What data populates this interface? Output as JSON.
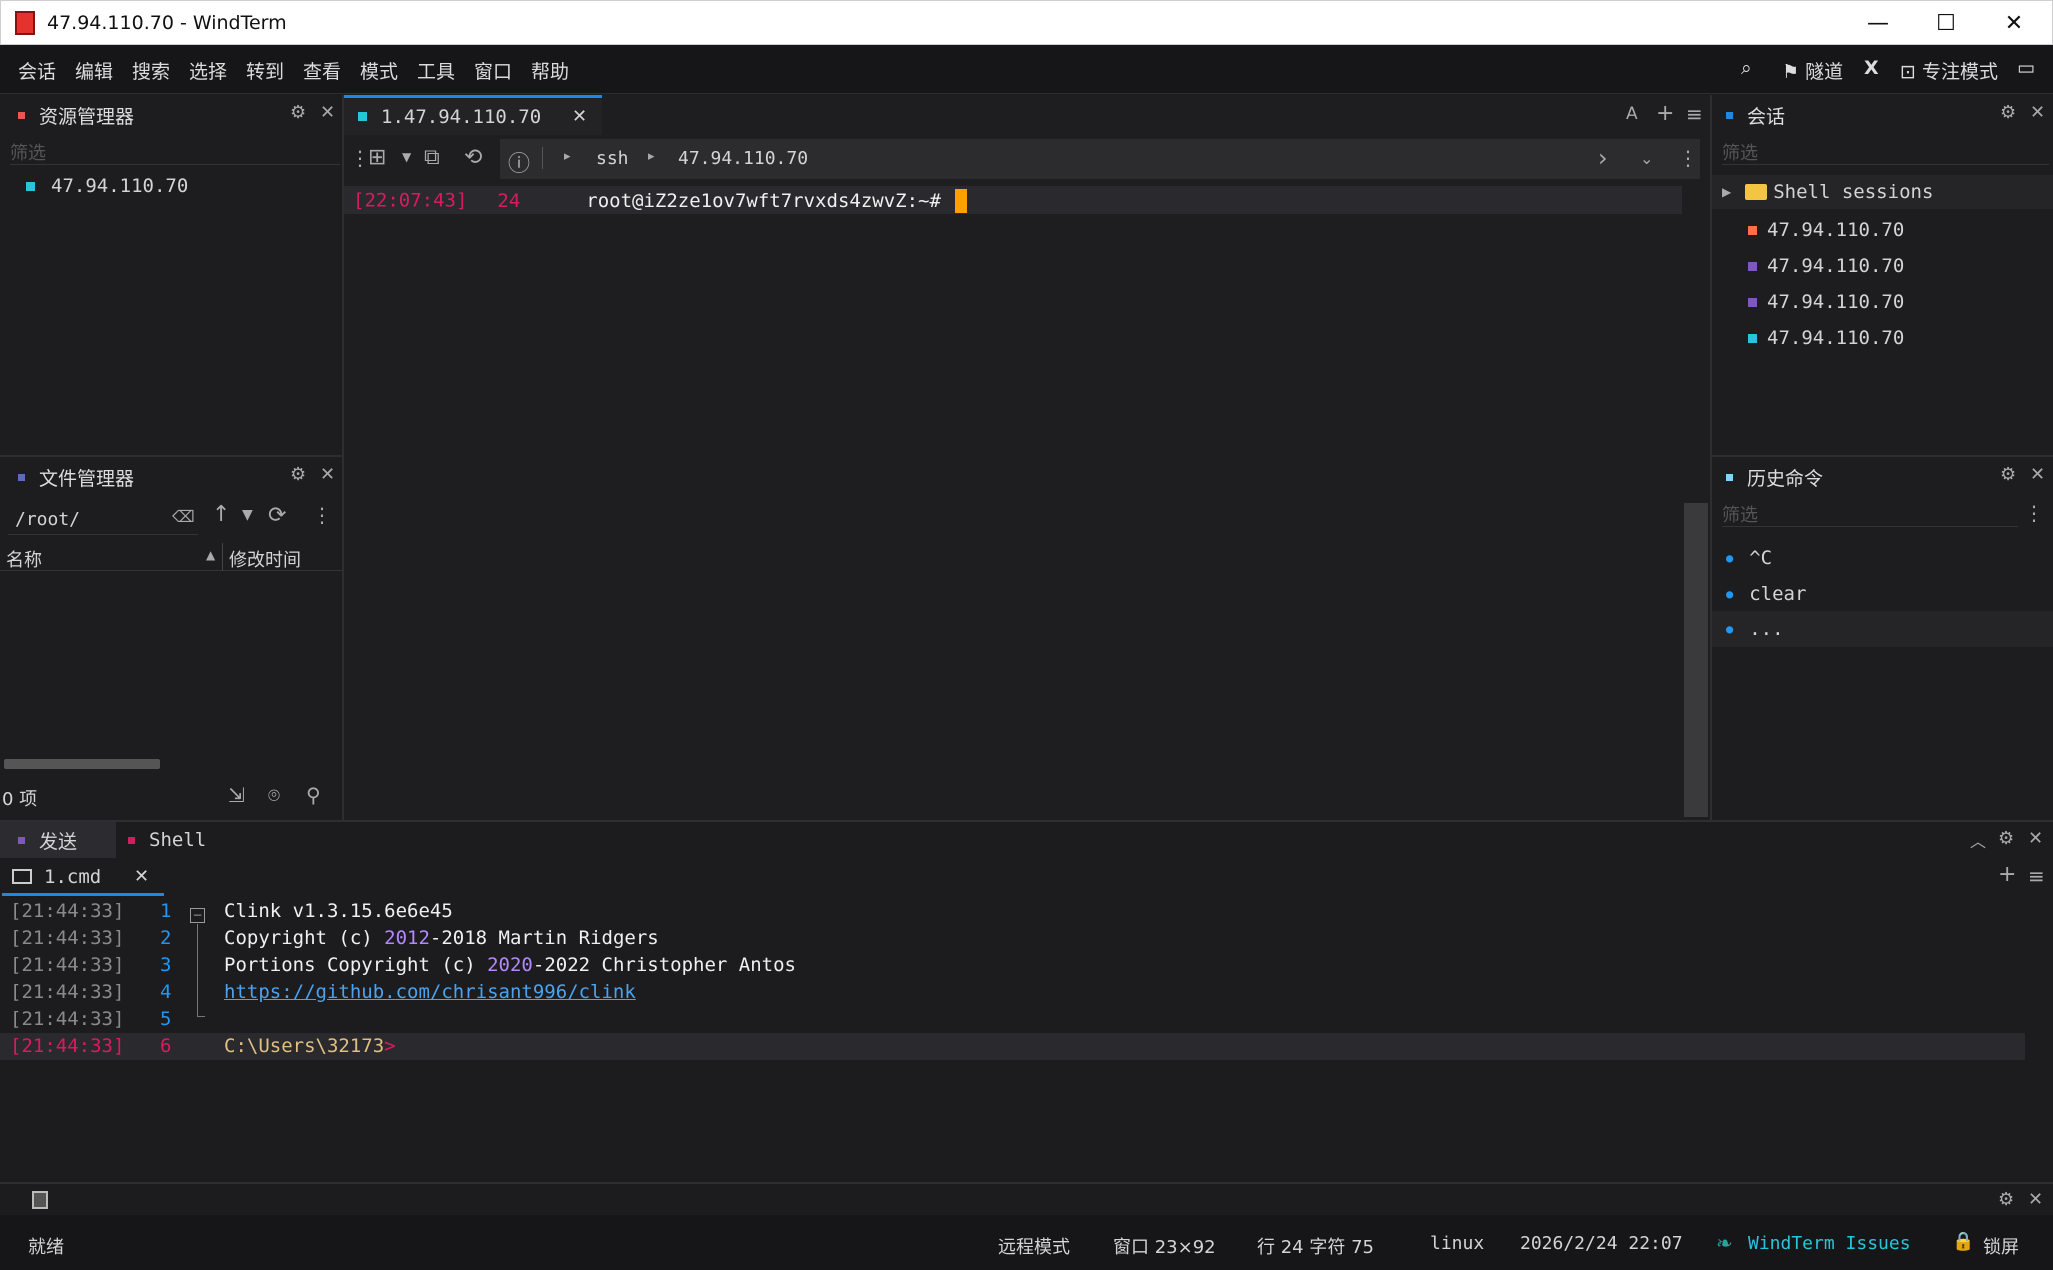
{
  "window": {
    "title": "47.94.110.70 - WindTerm",
    "min": "—",
    "max": "☐",
    "close": "✕"
  },
  "menu": [
    "会话",
    "编辑",
    "搜索",
    "选择",
    "转到",
    "查看",
    "模式",
    "工具",
    "窗口",
    "帮助"
  ],
  "right_menu": {
    "search_icon": "search-icon",
    "tunnel": "隧道",
    "x": "X",
    "focus": "专注模式"
  },
  "explorer": {
    "title": "资源管理器",
    "filter": "筛选",
    "items": [
      {
        "label": "47.94.110.70",
        "color": "#26c6da"
      }
    ]
  },
  "filemanager": {
    "title": "文件管理器",
    "path": "/root/",
    "col_name": "名称",
    "col_time": "修改时间",
    "count": "0 项"
  },
  "terminal": {
    "tab": "1.47.94.110.70",
    "breadcrumb": [
      "ssh",
      "47.94.110.70"
    ],
    "line": {
      "time": "[22:07:43]",
      "num": "24",
      "prompt": "root@iZ2ze1ov7wft7rvxds4zwvZ:~#"
    }
  },
  "sessions": {
    "title": "会话",
    "filter": "筛选",
    "folder": "Shell sessions",
    "items": [
      {
        "label": "47.94.110.70",
        "color": "#ff7043"
      },
      {
        "label": "47.94.110.70",
        "color": "#7e57c2"
      },
      {
        "label": "47.94.110.70",
        "color": "#7e57c2"
      },
      {
        "label": "47.94.110.70",
        "color": "#26c6da"
      }
    ]
  },
  "history": {
    "title": "历史命令",
    "filter": "筛选",
    "items": [
      "^C",
      "clear",
      "..."
    ]
  },
  "bottom": {
    "tabs": [
      "发送",
      "Shell"
    ],
    "subtab": "1.cmd",
    "lines": [
      {
        "time": "[21:44:33]",
        "num": "1",
        "parts": [
          [
            "Clink v1.3.15.6e6e45",
            "#f0f0f0"
          ]
        ]
      },
      {
        "time": "[21:44:33]",
        "num": "2",
        "parts": [
          [
            "Copyright ",
            "#f0f0f0"
          ],
          [
            "(c) ",
            "#f0f0f0"
          ],
          [
            "2012",
            "#b388ff"
          ],
          [
            "-2018 Martin Ridgers",
            "#f0f0f0"
          ]
        ]
      },
      {
        "time": "[21:44:33]",
        "num": "3",
        "parts": [
          [
            "Portions Copyright ",
            "#f0f0f0"
          ],
          [
            "(c) ",
            "#f0f0f0"
          ],
          [
            "2020",
            "#b388ff"
          ],
          [
            "-2022 Christopher Antos",
            "#f0f0f0"
          ]
        ]
      },
      {
        "time": "[21:44:33]",
        "num": "4",
        "parts": [
          [
            "https://github.com/chrisant996/clink",
            "#4aa3f0"
          ]
        ]
      },
      {
        "time": "[21:44:33]",
        "num": "5",
        "parts": []
      },
      {
        "time": "[21:44:33]",
        "num": "6",
        "parts": [
          [
            "C:\\Users\\32173",
            "#e0c080"
          ],
          [
            ">",
            "#d81b60"
          ]
        ]
      }
    ]
  },
  "status": {
    "ready": "就绪",
    "remote": "远程模式",
    "window": "窗口 23×92",
    "pos": "行 24 字符 75",
    "os": "linux",
    "datetime": "2026/2/24 22:07",
    "issues": "WindTerm Issues",
    "lock": "锁屏"
  }
}
